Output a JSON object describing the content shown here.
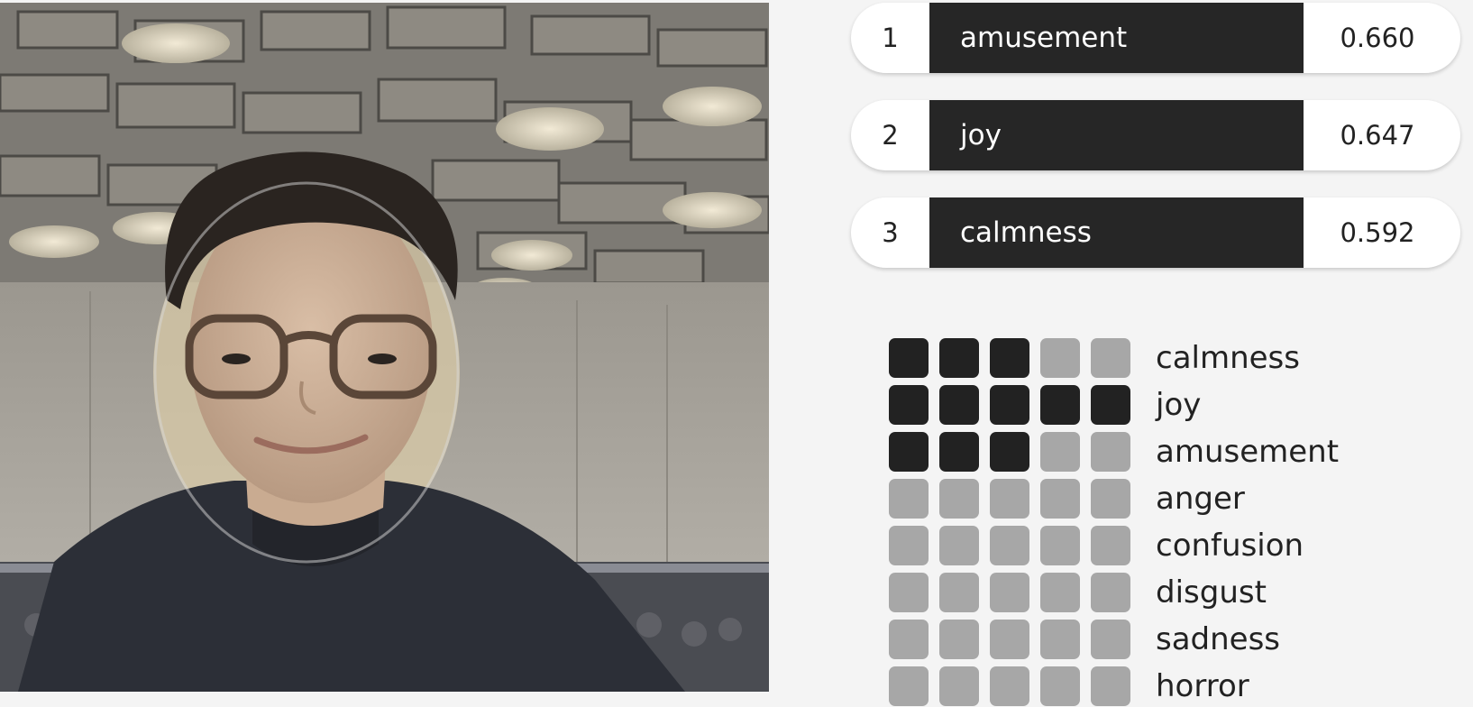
{
  "camera": {
    "description_icon": "webcam-feed"
  },
  "ranking": [
    {
      "rank": "1",
      "label": "amusement",
      "score": "0.660"
    },
    {
      "rank": "2",
      "label": "joy",
      "score": "0.647"
    },
    {
      "rank": "3",
      "label": "calmness",
      "score": "0.592"
    }
  ],
  "emotions": [
    {
      "label": "calmness",
      "level": 3
    },
    {
      "label": "joy",
      "level": 5
    },
    {
      "label": "amusement",
      "level": 3
    },
    {
      "label": "anger",
      "level": 0
    },
    {
      "label": "confusion",
      "level": 0
    },
    {
      "label": "disgust",
      "level": 0
    },
    {
      "label": "sadness",
      "level": 0
    },
    {
      "label": "horror",
      "level": 0
    }
  ],
  "grid_max_level": 5,
  "colors": {
    "bar": "#262626",
    "cell_on": "#222222",
    "cell_off": "#a7a7a7",
    "background": "#f4f4f4"
  }
}
